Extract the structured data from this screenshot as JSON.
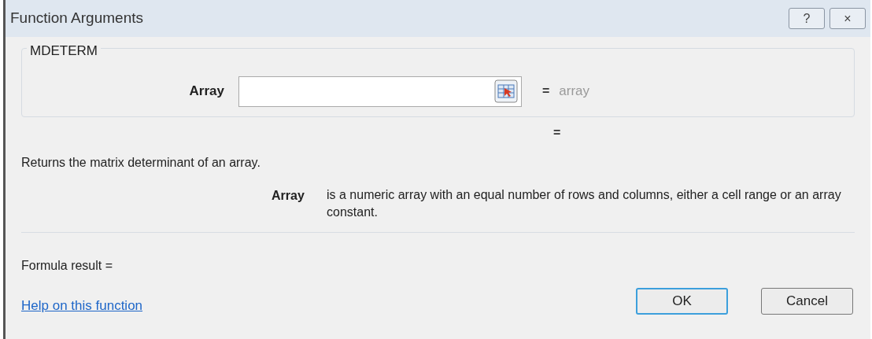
{
  "window": {
    "title": "Function Arguments",
    "controls": [
      "?",
      "×"
    ]
  },
  "function_name": "MDETERM",
  "arguments": [
    {
      "label": "Array",
      "equals": "=",
      "result": "array"
    }
  ],
  "result_equals": "=",
  "description": "Returns the matrix determinant of an array.",
  "argument_help": {
    "label": "Array",
    "text": "is a numeric array with an equal number of rows and columns, either a cell range or an array constant."
  },
  "formula_result": "Formula result =",
  "help_link": "Help on this function",
  "buttons": [
    {
      "label": "OK",
      "default": true
    },
    {
      "label": "Cancel",
      "default": false
    }
  ]
}
